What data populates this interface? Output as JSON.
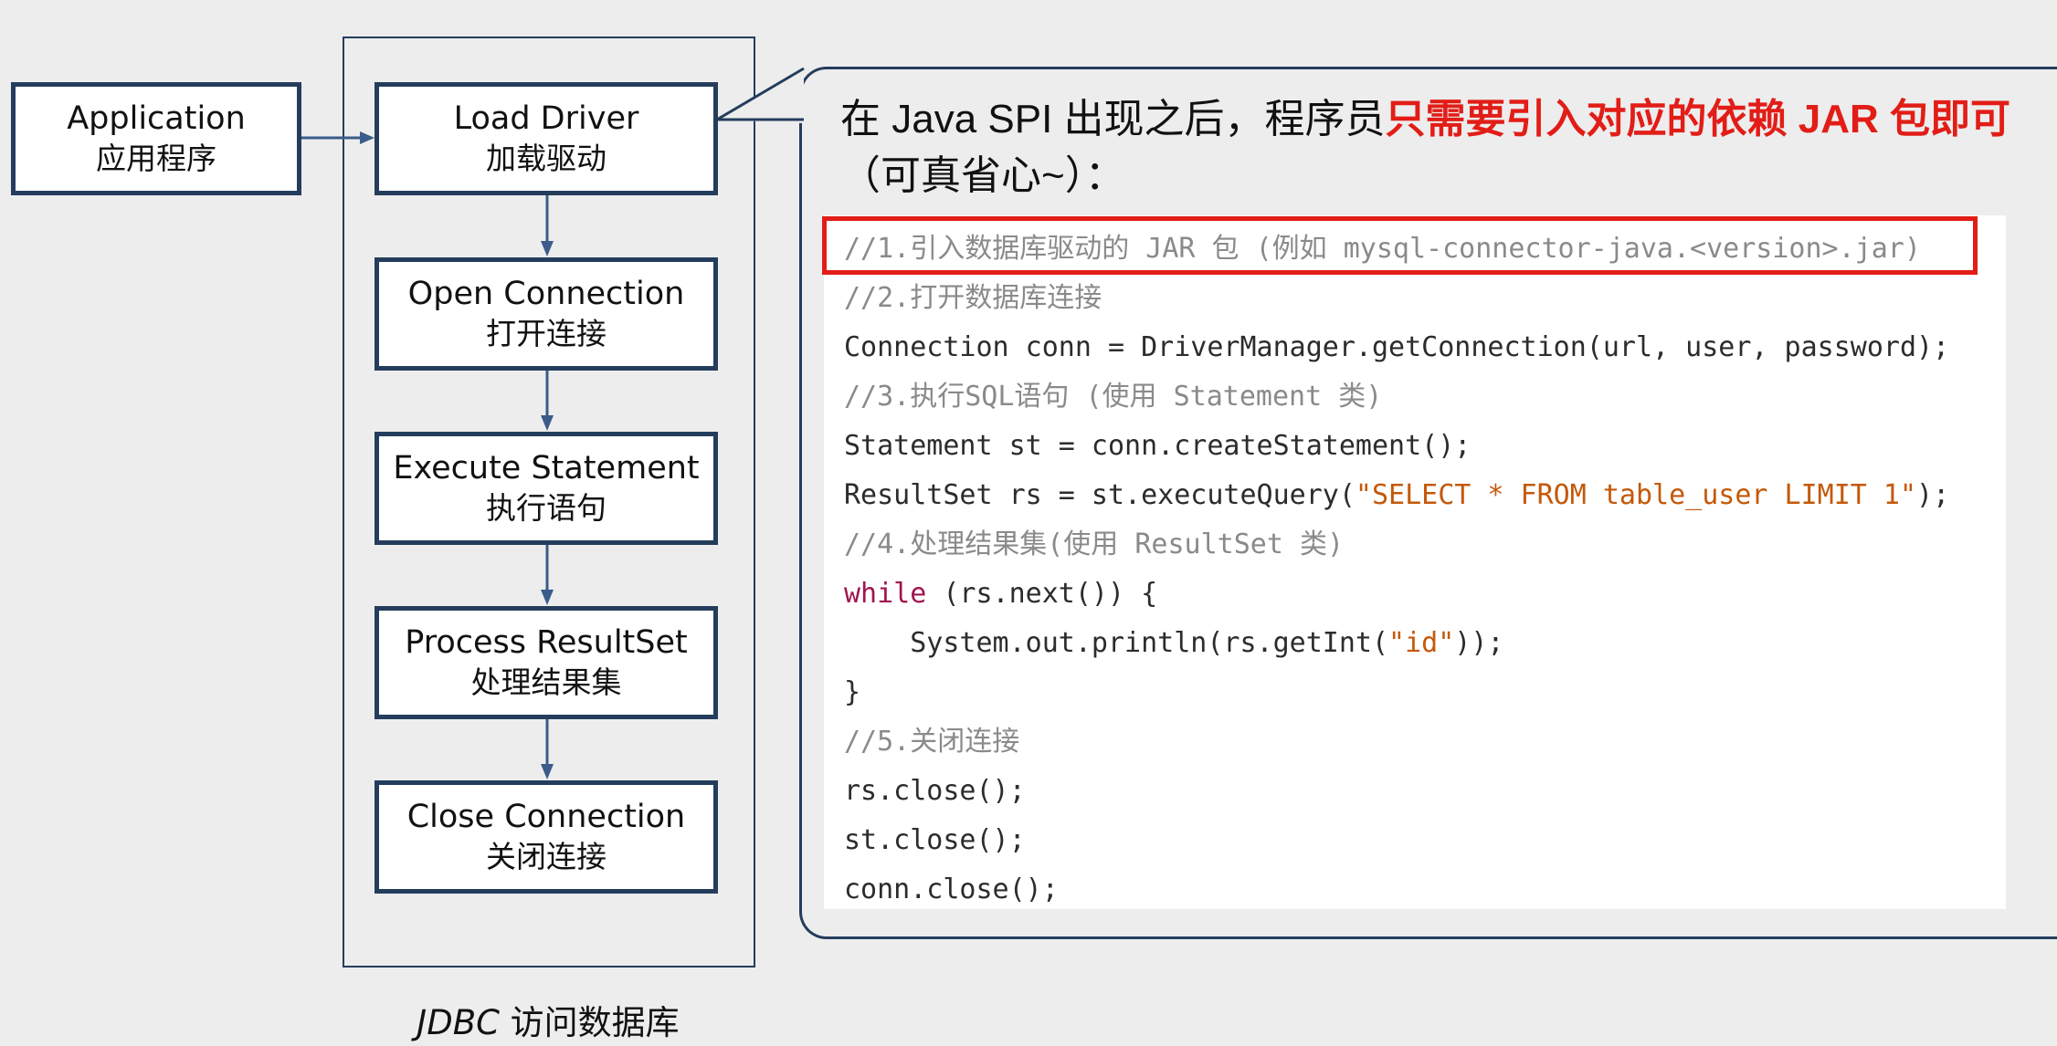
{
  "flow": {
    "application": {
      "en": "Application",
      "zh": "应用程序"
    },
    "steps": [
      {
        "en": "Load Driver",
        "zh": "加载驱动"
      },
      {
        "en": "Open Connection",
        "zh": "打开连接"
      },
      {
        "en": "Execute Statement",
        "zh": "执行语句"
      },
      {
        "en": "Process ResultSet",
        "zh": "处理结果集"
      },
      {
        "en": "Close Connection",
        "zh": "关闭连接"
      }
    ],
    "caption": {
      "jdbc": "JDBC",
      "rest": " 访问数据库"
    }
  },
  "callout": {
    "headline_before": "在 Java SPI 出现之后，程序员",
    "headline_highlight": "只需要引入对应的依赖 JAR 包即可",
    "headline_after": "（可真省心~）："
  },
  "code": {
    "lines": [
      "//1.引入数据库驱动的 JAR 包 (例如 mysql-connector-java.<version>.jar)",
      "//2.打开数据库连接",
      "Connection conn = DriverManager.getConnection(url, user, password);",
      "//3.执行SQL语句 (使用 Statement 类)",
      "Statement st = conn.createStatement();",
      "ResultSet rs = st.executeQuery(",
      "\"SELECT * FROM table_user LIMIT 1\"",
      ");",
      "//4.处理结果集(使用 ResultSet 类)",
      "while",
      " (rs.next()) {",
      "    System.out.println(rs.getInt(",
      "\"id\"",
      "));",
      "}",
      "//5.关闭连接",
      "rs.close();",
      "st.close();",
      "conn.close();"
    ]
  },
  "colors": {
    "box_border": "#243d5c",
    "highlight_red": "#e21d17",
    "keyword": "#a1154f",
    "string": "#c4590a",
    "comment": "#8a8a8a"
  }
}
